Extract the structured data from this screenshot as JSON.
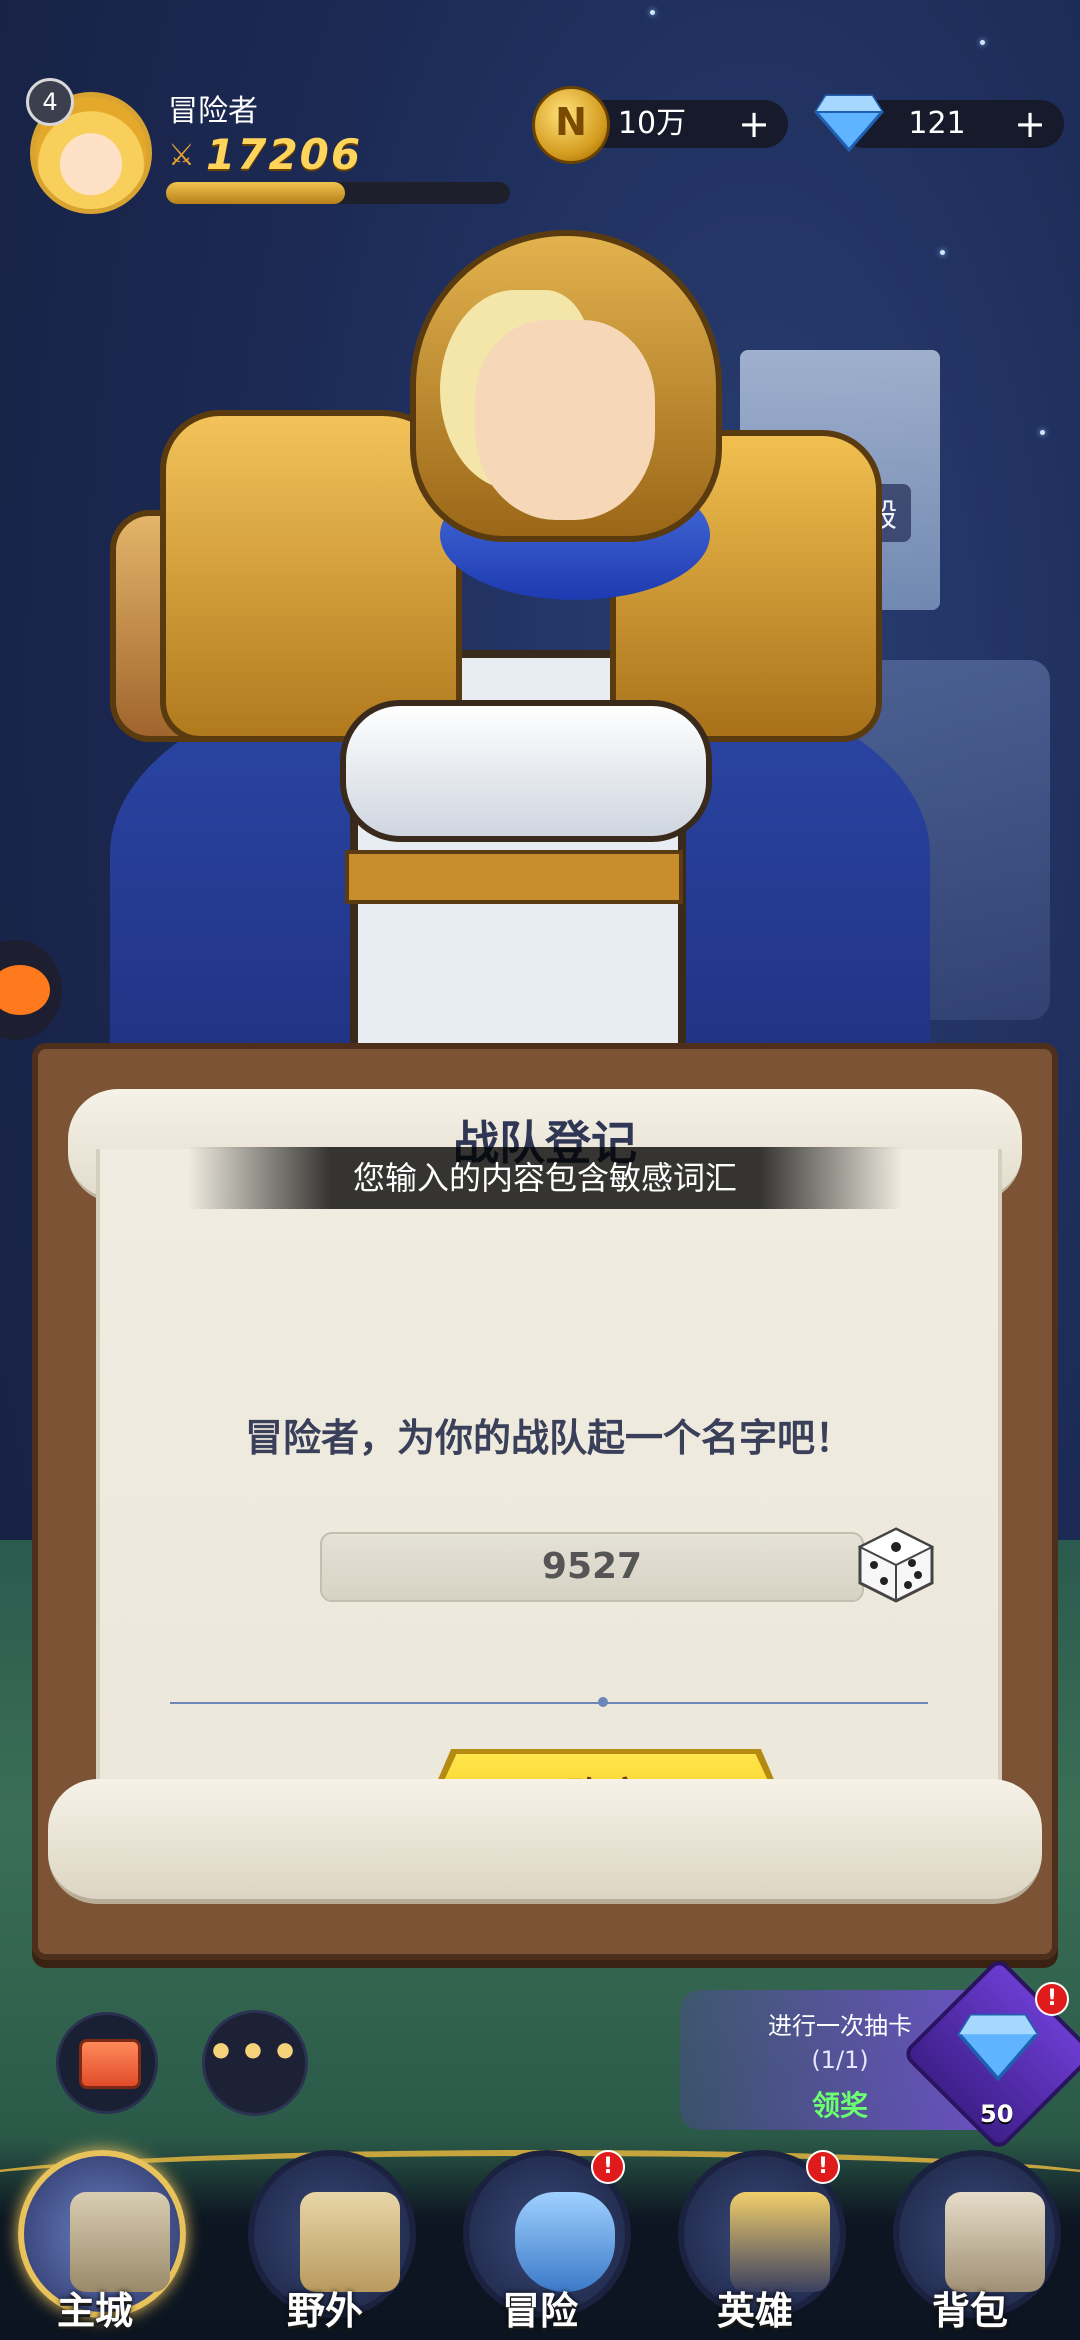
{
  "player": {
    "level": "4",
    "name": "冒险者",
    "power": "17206",
    "xp_progress": 0.52
  },
  "resources": {
    "coins": "10万",
    "gems": "121"
  },
  "scene": {
    "temple_label": "英雄神殿"
  },
  "dialog": {
    "title": "战队登记",
    "toast": "您输入的内容包含敏感词汇",
    "prompt": "冒险者，为你的战队起一个名字吧！",
    "name_value": "9527",
    "confirm_label": "确定"
  },
  "draw": {
    "title": "进行一次抽卡",
    "count": "(1/1)",
    "claim_label": "领奖",
    "cost": "50",
    "badge": "!"
  },
  "nav": {
    "items": [
      {
        "label": "主城",
        "badge": ""
      },
      {
        "label": "野外",
        "badge": ""
      },
      {
        "label": "冒险",
        "badge": "!"
      },
      {
        "label": "英雄",
        "badge": "!"
      },
      {
        "label": "背包",
        "badge": ""
      }
    ]
  },
  "colors": {
    "accent_gold": "#e8c25a",
    "confirm_yellow": "#ffe64a",
    "alert_red": "#e01b1b",
    "draw_purple": "#6c3cd1"
  }
}
